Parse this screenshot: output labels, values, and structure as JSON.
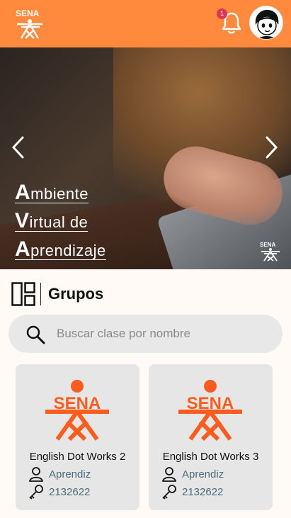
{
  "header": {
    "notification_count": "1",
    "icons": [
      "sena-logo",
      "bell-icon",
      "user-avatar"
    ],
    "brand_color": "#ff8a3d"
  },
  "banner": {
    "line1_cap": "A",
    "line1_rest": "mbiente",
    "line2_cap": "V",
    "line2_rest": "irtual de",
    "line3_cap": "A",
    "line3_rest": "prendizaje"
  },
  "section": {
    "title": "Grupos"
  },
  "search": {
    "placeholder": "Buscar clase por nombre"
  },
  "cards": [
    {
      "name": "English Dot Works 2",
      "role": "Aprendiz",
      "code": "2132622"
    },
    {
      "name": "English Dot Works 3",
      "role": "Aprendiz",
      "code": "2132622"
    }
  ],
  "colors": {
    "sena_orange": "#fc5c1d",
    "link_text": "#4d6b78"
  }
}
